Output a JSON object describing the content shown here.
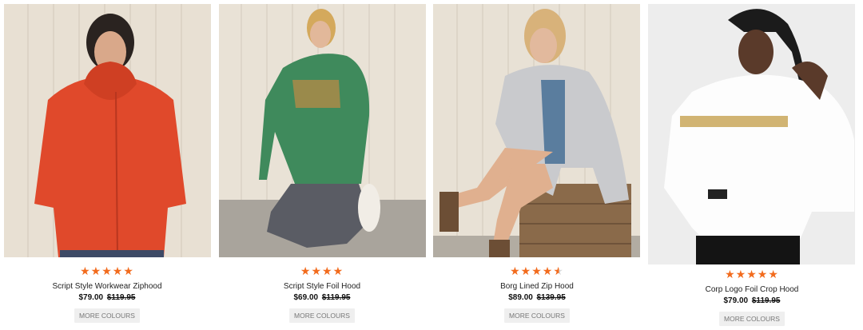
{
  "colors": {
    "star": "#f26b1d",
    "wall": "#e7dfd2",
    "background": "#ffffff"
  },
  "products": [
    {
      "title": "Script Style Workwear Ziphood",
      "price": "$79.00",
      "was_price": "$119.95",
      "rating": 5,
      "more_label": "MORE COLOURS"
    },
    {
      "title": "Script Style Foil Hood",
      "price": "$69.00",
      "was_price": "$119.95",
      "rating": 4,
      "more_label": "MORE COLOURS"
    },
    {
      "title": "Borg Lined Zip Hood",
      "price": "$89.00",
      "was_price": "$139.95",
      "rating": 4.5,
      "more_label": "MORE COLOURS"
    },
    {
      "title": "Corp Logo Foil Crop Hood",
      "price": "$79.00",
      "was_price": "$119.95",
      "rating": 5,
      "more_label": "MORE COLOURS"
    }
  ]
}
